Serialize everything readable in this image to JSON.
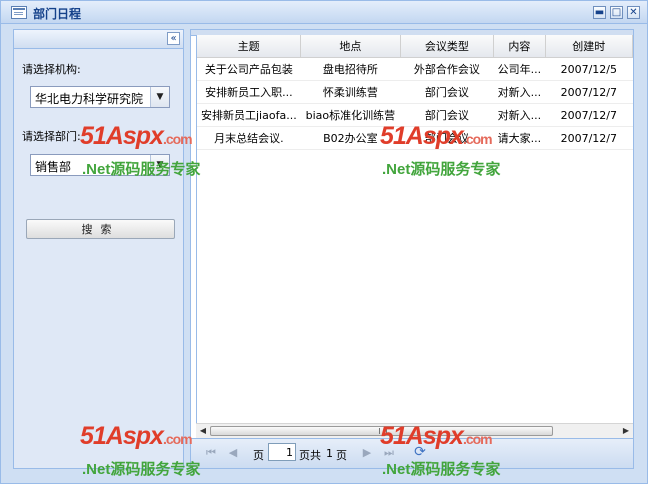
{
  "window": {
    "title": "部门日程",
    "minimize": "▬",
    "maximize": "□",
    "close": "✕"
  },
  "left": {
    "collapse": "«",
    "org_label": "请选择机构:",
    "org_value": "华北电力科学研究院",
    "dept_label": "请选择部门:",
    "dept_value": "销售部",
    "search_label": "搜索"
  },
  "grid": {
    "columns": [
      "主题",
      "地点",
      "会议类型",
      "内容",
      "创建时"
    ],
    "rows": [
      [
        "关于公司产品包装",
        "盘电招待所",
        "外部合作会议",
        "公司年...",
        "2007/12/5"
      ],
      [
        "安排新员工入职...",
        "怀柔训练营",
        "部门会议",
        "对新入...",
        "2007/12/7"
      ],
      [
        "安排新员工jiaofa...",
        "biao标准化训练营",
        "部门会议",
        "对新入...",
        "2007/12/7"
      ],
      [
        "月末总结会议.",
        "B02办公室",
        "部门会议",
        "请大家...",
        "2007/12/7"
      ]
    ]
  },
  "pager": {
    "page_label": "页",
    "page_value": "1",
    "total_label": "页共",
    "total_value": "1",
    "total_unit": "页"
  },
  "watermark": {
    "logo": "51Aspx",
    "suffix": ".com",
    "tagline": ".Net源码服务专家"
  }
}
